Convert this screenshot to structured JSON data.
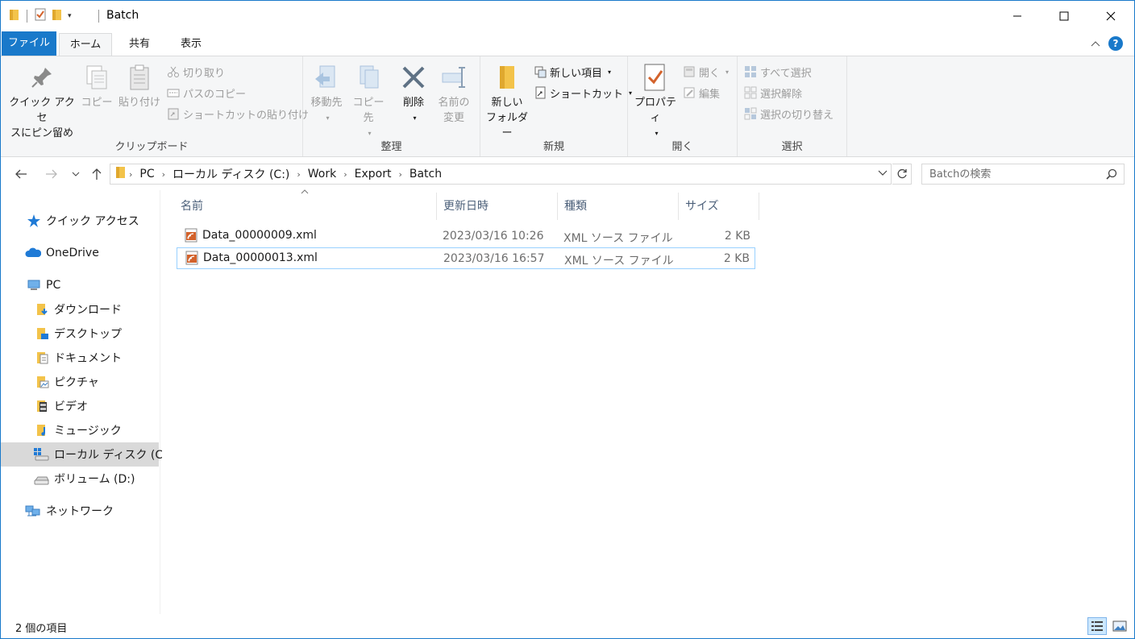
{
  "window": {
    "title": "Batch"
  },
  "ribbon_tabs": {
    "file": "ファイル",
    "home": "ホーム",
    "share": "共有",
    "view": "表示"
  },
  "ribbon": {
    "clipboard": {
      "label": "クリップボード",
      "pin_line1": "クイック アクセ",
      "pin_line2": "スにピン留め",
      "copy": "コピー",
      "paste": "貼り付け",
      "cut": "切り取り",
      "copy_path": "パスのコピー",
      "paste_shortcut": "ショートカットの貼り付け"
    },
    "organize": {
      "label": "整理",
      "move_to": "移動先",
      "copy_to": "コピー先",
      "delete": "削除",
      "rename_line1": "名前の",
      "rename_line2": "変更"
    },
    "new": {
      "label": "新規",
      "new_folder_line1": "新しい",
      "new_folder_line2": "フォルダー",
      "new_item": "新しい項目",
      "shortcut": "ショートカット"
    },
    "open": {
      "label": "開く",
      "properties": "プロパティ",
      "open": "開く",
      "edit": "編集"
    },
    "select": {
      "label": "選択",
      "select_all": "すべて選択",
      "select_none": "選択解除",
      "invert": "選択の切り替え"
    }
  },
  "address": {
    "crumbs": [
      "PC",
      "ローカル ディスク (C:)",
      "Work",
      "Export",
      "Batch"
    ],
    "search_placeholder": "Batchの検索"
  },
  "nav": {
    "quick_access": "クイック アクセス",
    "onedrive": "OneDrive",
    "pc": "PC",
    "downloads": "ダウンロード",
    "desktop": "デスクトップ",
    "documents": "ドキュメント",
    "pictures": "ピクチャ",
    "videos": "ビデオ",
    "music": "ミュージック",
    "local_disk": "ローカル ディスク (C:)",
    "volume_d": "ボリューム (D:)",
    "network": "ネットワーク"
  },
  "columns": {
    "name": "名前",
    "date": "更新日時",
    "type": "種類",
    "size": "サイズ"
  },
  "files": [
    {
      "name": "Data_00000009.xml",
      "date": "2023/03/16 10:26",
      "type": "XML ソース ファイル",
      "size": "2 KB"
    },
    {
      "name": "Data_00000013.xml",
      "date": "2023/03/16 16:57",
      "type": "XML ソース ファイル",
      "size": "2 KB"
    }
  ],
  "status": {
    "item_count": "2 個の項目"
  },
  "colors": {
    "accent": "#1979ca",
    "folder": "#f3c34a",
    "xml_icon": "#d3622b",
    "selection_border": "#99d1ff"
  }
}
